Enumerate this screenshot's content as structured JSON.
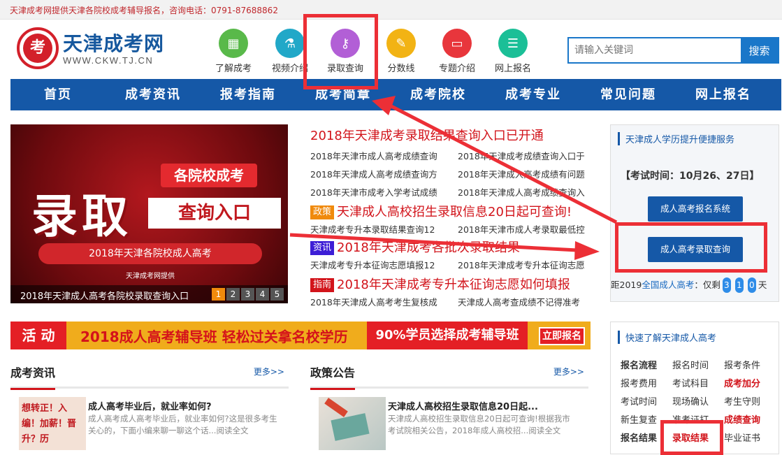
{
  "topbar": {
    "text": "天津成考网提供天津各院校成考辅导报名，咨询电话：0791-87688862"
  },
  "logo": {
    "name": "天津成考网",
    "url": "WWW.CKW.TJ.CN",
    "badge": "考"
  },
  "quick_nav": [
    {
      "label": "了解成考",
      "color": "#59b94a",
      "icon": "building-icon",
      "glyph": "▦"
    },
    {
      "label": "视频介绍",
      "color": "#21a8c8",
      "icon": "flask-icon",
      "glyph": "⚗"
    },
    {
      "label": "录取查询",
      "color": "#b25fd6",
      "icon": "key-icon",
      "glyph": "⚷"
    },
    {
      "label": "分数线",
      "color": "#f2b314",
      "icon": "pen-icon",
      "glyph": "✎"
    },
    {
      "label": "专题介绍",
      "color": "#e8363c",
      "icon": "laptop-icon",
      "glyph": "▭"
    },
    {
      "label": "网上报名",
      "color": "#1bbf97",
      "icon": "form-icon",
      "glyph": "☰"
    }
  ],
  "search": {
    "placeholder": "请输入关键词",
    "button": "搜索"
  },
  "main_nav": [
    "首页",
    "成考资讯",
    "报考指南",
    "成考简章",
    "成考院校",
    "成考专业",
    "常见问题",
    "网上报名"
  ],
  "banner": {
    "tag": "各院校成考",
    "big": "录取",
    "sub": "查询入口",
    "ribbon": "2018年天津各院校成人高考",
    "provider": "天津成考网提供",
    "caption": "2018年天津成人高考各院校录取查询入口",
    "pages": [
      "1",
      "2",
      "3",
      "4",
      "5"
    ]
  },
  "news": {
    "top_headline": "2018年天津成考录取结果查询入口已开通",
    "groups": [
      {
        "links": [
          "2018年天津市成人高考成绩查询",
          "2018年天津成考成绩查询入口于",
          "2018年天津成人高考成绩查询方",
          "2018年天津成人高考成绩有问题",
          "2018年天津市成考入学考试成绩",
          "2018年天津成人高考成绩查询入"
        ]
      },
      {
        "tag": "政策",
        "tag_color": "#f08a0c",
        "headline": "天津成人高校招生录取信息20日起可查询!",
        "links": [
          "天津成考专升本录取结果查询12",
          "2018年天津市成人考录取最低控"
        ]
      },
      {
        "tag": "资讯",
        "tag_color": "#3d1ed6",
        "headline": "2018年天津成考各批次录取结果",
        "links": [
          "天津成考专升本征询志愿填报12",
          "2018年天津成考专升本征询志愿"
        ]
      },
      {
        "tag": "指南",
        "tag_color": "#d2141b",
        "headline": "2018年天津成考专升本征询志愿如何填报",
        "links": [
          "2018年天津成人高考考生复核成",
          "天津成人高考查成绩不记得准考"
        ]
      }
    ]
  },
  "service": {
    "title": "天津成人学历提升便捷服务",
    "exam_time": "【考试时间：10月26、27日】",
    "btn_register": "成人高考报名系统",
    "btn_result": "成人高考录取查询",
    "countdown_prefix": "距2019",
    "countdown_link": "全国成人高考",
    "countdown_mid": "：仅剩",
    "countdown_digits": [
      "3",
      "1",
      "0"
    ],
    "countdown_suffix": "天"
  },
  "ad": {
    "left": "活 动",
    "main": "2018成人高考辅导班 轻松过关拿名校学历",
    "pct": "90%学员选择成考辅导班",
    "go": "立即报名"
  },
  "sections": [
    {
      "title": "成考资讯",
      "more": "更多>>",
      "article_title": "成人高考毕业后，就业率如何?",
      "article_body": "成人高考成人高考毕业后，就业率如何?这是很多考生关心的，下面小编来聊一聊这个话...阅读全文",
      "thumb_text": "想转正！入编！加薪！晋升？历"
    },
    {
      "title": "政策公告",
      "more": "更多>>",
      "article_title": "天津成人高校招生录取信息20日起...",
      "article_body": "天津成人高校招生录取信息20日起可查询!根据我市考试院相关公告，2018年成人高校招...阅读全文"
    }
  ],
  "quick_know": {
    "title": "快速了解天津成人高考",
    "items": [
      {
        "label": "报名流程",
        "style": "bold"
      },
      {
        "label": "报名时间",
        "style": "normal"
      },
      {
        "label": "报考条件",
        "style": "normal"
      },
      {
        "label": "报考费用",
        "style": "normal"
      },
      {
        "label": "考试科目",
        "style": "normal"
      },
      {
        "label": "成考加分",
        "style": "red"
      },
      {
        "label": "考试时间",
        "style": "normal"
      },
      {
        "label": "现场确认",
        "style": "normal"
      },
      {
        "label": "考生守则",
        "style": "normal"
      },
      {
        "label": "新生复查",
        "style": "normal"
      },
      {
        "label": "准考证打",
        "style": "normal"
      },
      {
        "label": "成绩查询",
        "style": "red"
      },
      {
        "label": "报名结果",
        "style": "bold"
      },
      {
        "label": "录取结果",
        "style": "red"
      },
      {
        "label": "毕业证书",
        "style": "normal"
      }
    ]
  },
  "annotation": {
    "color": "#ec2f36"
  }
}
